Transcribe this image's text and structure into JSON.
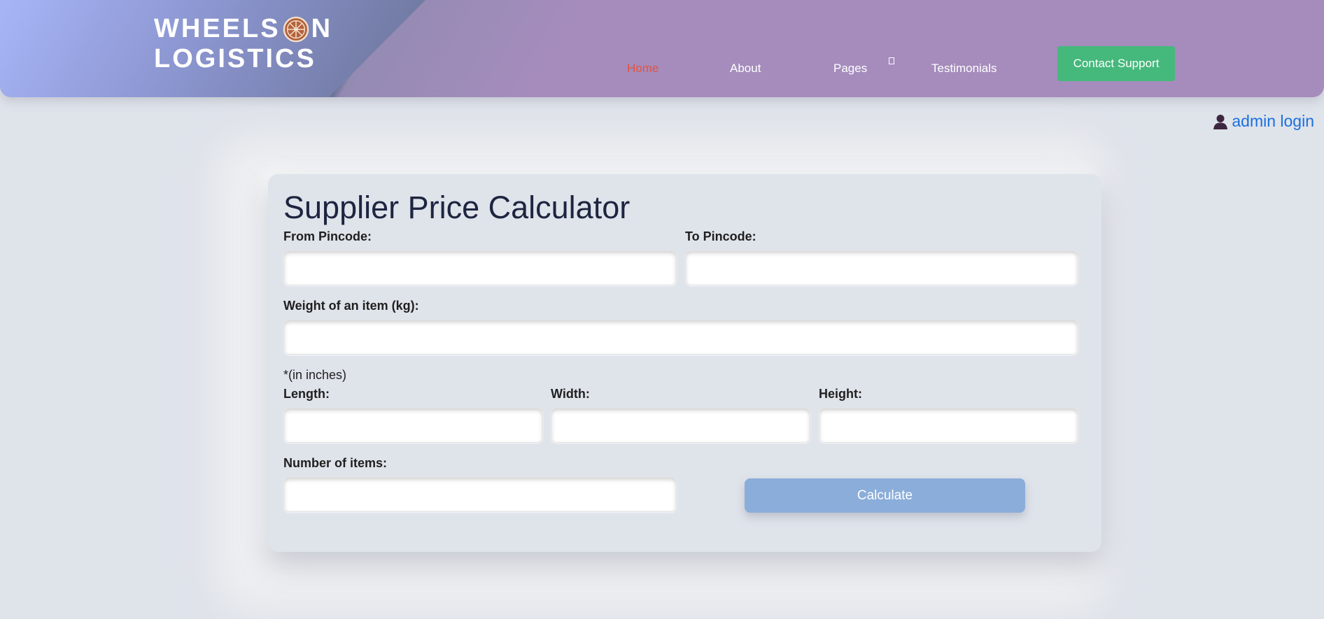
{
  "header": {
    "logo_line1_a": "WHEELS",
    "logo_line1_b": "N",
    "logo_line2": "LOGISTICS",
    "nav": [
      {
        "label": "Home",
        "active": true
      },
      {
        "label": "About",
        "active": false
      },
      {
        "label": "Pages",
        "active": false
      },
      {
        "label": "Testimonials",
        "active": false
      }
    ],
    "contact_label": "Contact Support"
  },
  "admin": {
    "label": "admin login"
  },
  "calculator": {
    "title": "Supplier Price Calculator",
    "from_label": "From Pincode:",
    "to_label": "To Pincode:",
    "weight_label": "Weight of an item (kg):",
    "dimensions_note": "*(in inches)",
    "length_label": "Length:",
    "width_label": "Width:",
    "height_label": "Height:",
    "count_label": "Number of items:",
    "calculate_label": "Calculate"
  },
  "colors": {
    "accent_active_nav": "#e5533d",
    "contact_button": "#45b87c",
    "calculate_button": "#8badda",
    "link": "#1a6fe0"
  },
  "icons": [
    "wheel-icon",
    "user-icon",
    "chevron-down-icon"
  ]
}
